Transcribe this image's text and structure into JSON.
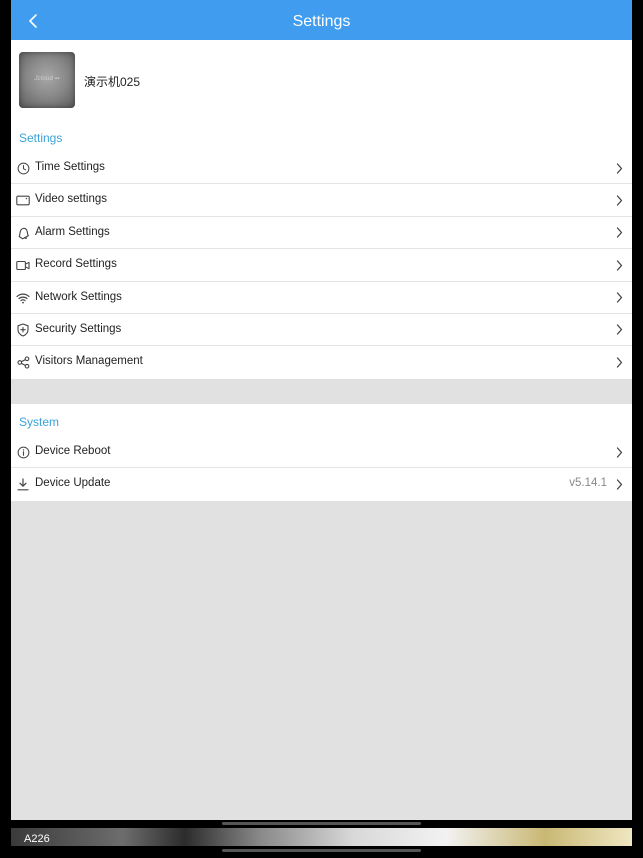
{
  "navbar": {
    "title": "Settings",
    "back_icon": "chevron-left-icon"
  },
  "device": {
    "name": "演示机025",
    "thumbnail_watermark": "Jcloud ▪▪"
  },
  "settings_section": {
    "header": "Settings",
    "items": [
      {
        "label": "Time Settings",
        "icon": "clock-icon"
      },
      {
        "label": "Video settings",
        "icon": "video-screen-icon"
      },
      {
        "label": "Alarm Settings",
        "icon": "bell-icon"
      },
      {
        "label": "Record Settings",
        "icon": "camcorder-icon"
      },
      {
        "label": "Network Settings",
        "icon": "wifi-icon"
      },
      {
        "label": "Security Settings",
        "icon": "shield-icon"
      },
      {
        "label": "Visitors Management",
        "icon": "share-icon"
      }
    ]
  },
  "system_section": {
    "header": "System",
    "items": [
      {
        "label": "Device Reboot",
        "icon": "info-icon",
        "value": ""
      },
      {
        "label": "Device Update",
        "icon": "download-icon",
        "value": "v5.14.1"
      }
    ]
  },
  "bottom_strip": {
    "tag": "A226"
  },
  "colors": {
    "navbar": "#3f9cee",
    "section_header": "#3aa3d8",
    "background": "#e1e1e1"
  }
}
